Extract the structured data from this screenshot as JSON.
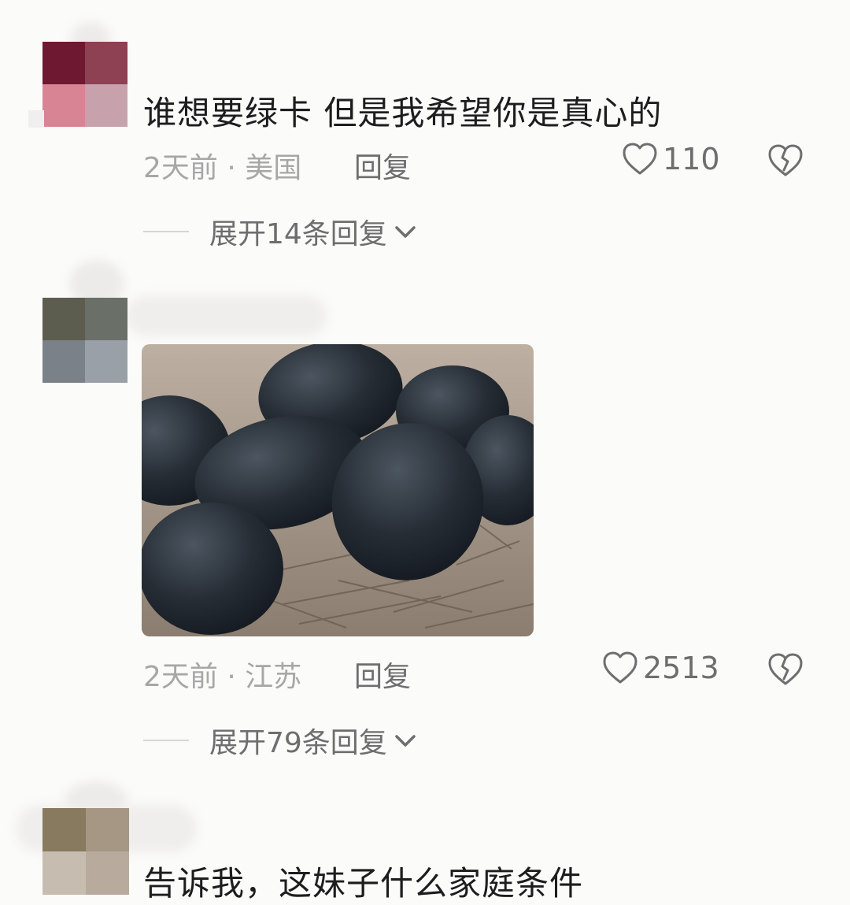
{
  "comments": [
    {
      "text": "谁想要绿卡  但是我希望你是真心的",
      "meta": "2天前 · 美国",
      "reply_label": "回复",
      "likes": "110",
      "expand_label": "展开14条回复"
    },
    {
      "image_icon": "black-eggs-photo",
      "meta": "2天前 · 江苏",
      "reply_label": "回复",
      "likes": "2513",
      "expand_label": "展开79条回复"
    },
    {
      "text": "告诉我，这妹子什么家庭条件"
    }
  ],
  "icons": {
    "like": "heart-outline-icon",
    "dislike": "broken-heart-icon",
    "expand": "chevron-down-icon"
  },
  "colors": {
    "background": "#fbfbf9",
    "text_primary": "#1d1d1d",
    "text_secondary": "#a7a7a7",
    "action": "#6e6e6e"
  }
}
